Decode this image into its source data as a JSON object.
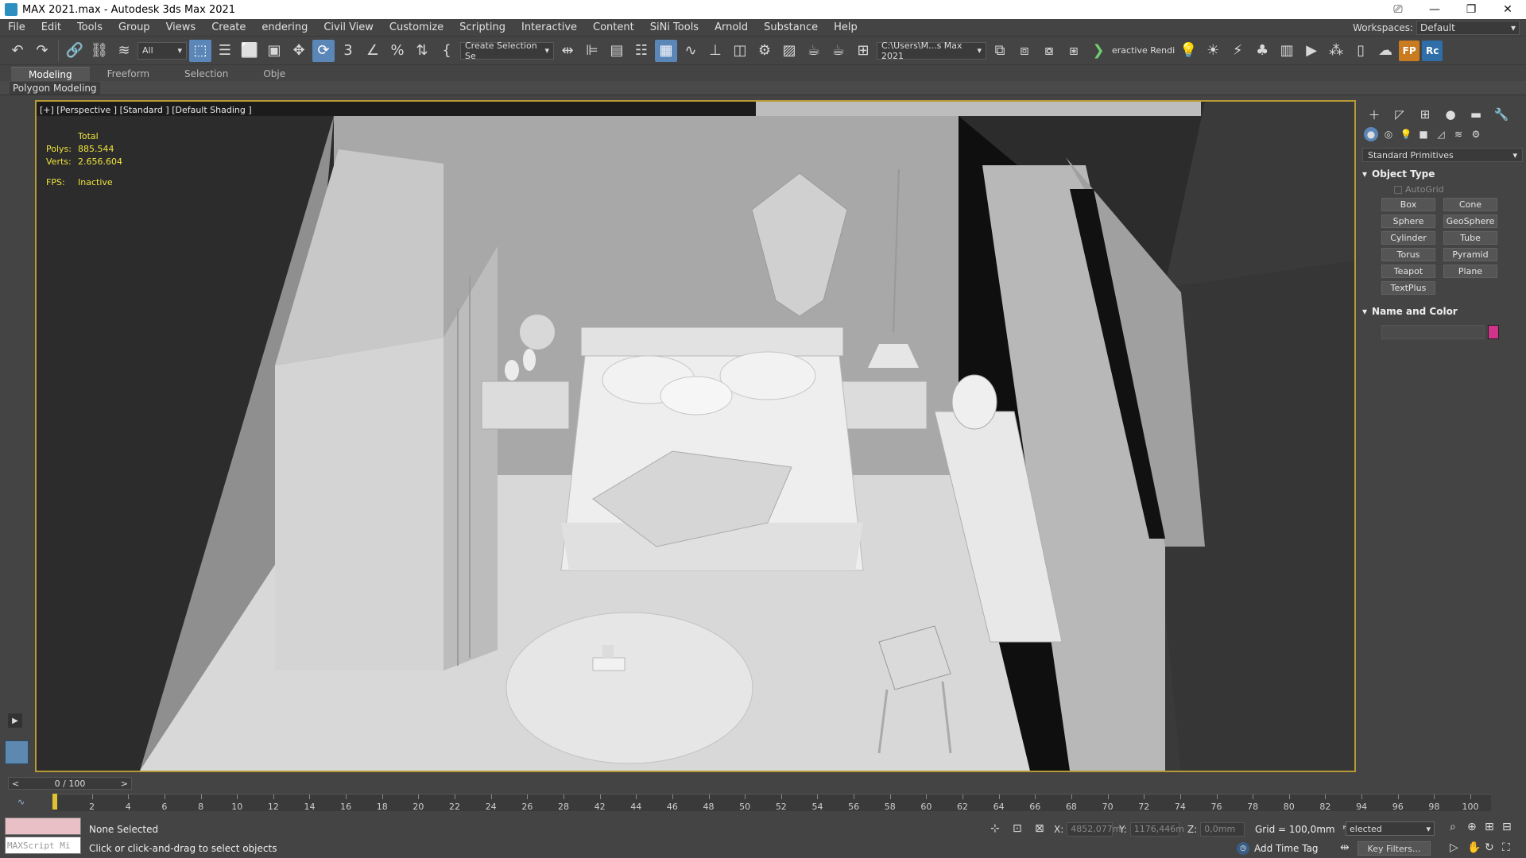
{
  "titlebar": {
    "title": "MAX 2021.max - Autodesk 3ds Max 2021",
    "min": "—",
    "restore": "❐",
    "close": "✕",
    "extra": "⎚"
  },
  "menu": [
    "File",
    "Edit",
    "Tools",
    "Group",
    "Views",
    "Create",
    "endering",
    "Civil View",
    "Customize",
    "Scripting",
    "Interactive",
    "Content",
    "SiNi Tools",
    "Arnold",
    "Substance",
    "Help"
  ],
  "workspaces": {
    "label": "Workspaces:",
    "value": "Default"
  },
  "toolbar": {
    "filter": "All",
    "named_selection": "Create Selection Se",
    "path": "C:\\Users\\M...s Max 2021",
    "interactive_render": "eractive Rendi",
    "fp_label": "FP",
    "rc_label": "Rc"
  },
  "ribbon": {
    "tabs": [
      "Modeling",
      "Freeform",
      "Selection",
      "Obje"
    ],
    "panel": "Polygon Modeling"
  },
  "viewport": {
    "label": "[+] [Perspective ] [Standard ] [Default Shading ]",
    "stats": {
      "total": "Total",
      "polys_label": "Polys:",
      "polys": "885.544",
      "verts_label": "Verts:",
      "verts": "2.656.604",
      "fps_label": "FPS:",
      "fps": "Inactive"
    }
  },
  "command_panel": {
    "dropdown": "Standard Primitives",
    "object_type": "Object Type",
    "autogrid": "AutoGrid",
    "primitives": [
      "Box",
      "Cone",
      "Sphere",
      "GeoSphere",
      "Cylinder",
      "Tube",
      "Torus",
      "Pyramid",
      "Teapot",
      "Plane",
      "TextPlus"
    ],
    "name_and_color": "Name and Color",
    "color": "#d0338a"
  },
  "time": {
    "counter": "0 / 100",
    "prev": "<",
    "next": ">",
    "ticks": [
      "0",
      "2",
      "4",
      "6",
      "8",
      "10",
      "12",
      "14",
      "16",
      "18",
      "20",
      "22",
      "24",
      "26",
      "28",
      "42",
      "44",
      "46",
      "48",
      "50",
      "52",
      "54",
      "56",
      "58",
      "60",
      "62",
      "64",
      "66",
      "68",
      "70",
      "72",
      "74",
      "76",
      "78",
      "80",
      "82",
      "94",
      "96",
      "98",
      "100"
    ]
  },
  "status": {
    "maxscript": "MAXScript Mi",
    "selection": "None Selected",
    "hint": "Click or click-and-drag to select objects",
    "x_label": "X:",
    "x": "4852,077m",
    "y_label": "Y:",
    "y": "1176,446m",
    "z_label": "Z:",
    "z": "0,0mm",
    "grid": "Grid = 100,0mm",
    "sel_dropdown": "elected",
    "add_time_tag": "Add Time Tag",
    "key_filters": "Key Filters..."
  }
}
